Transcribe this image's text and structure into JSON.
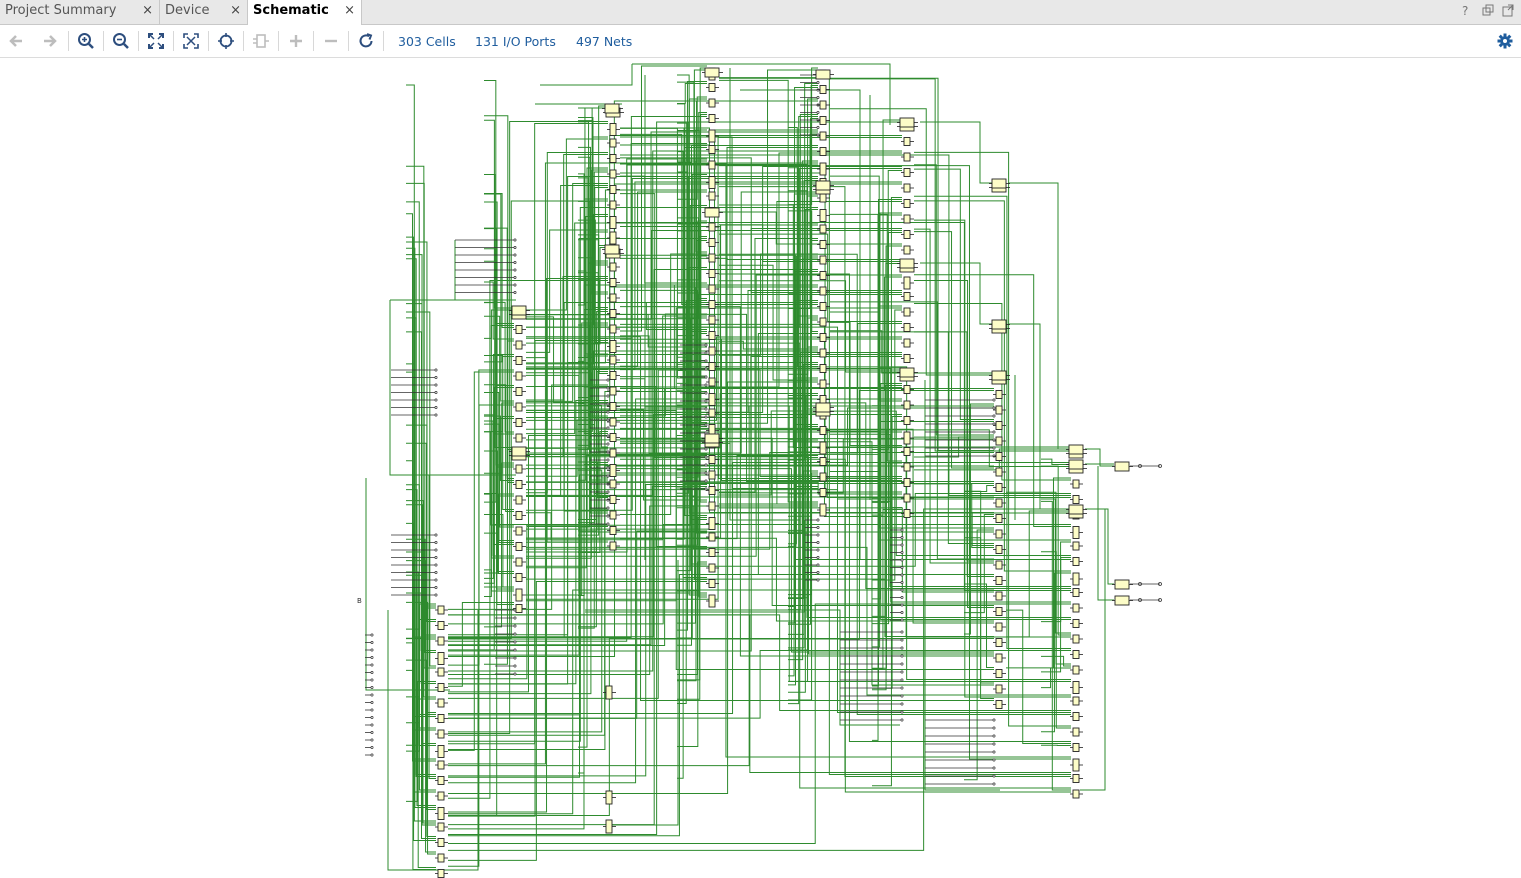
{
  "tabs": [
    {
      "label": "Project Summary",
      "active": false
    },
    {
      "label": "Device",
      "active": false
    },
    {
      "label": "Schematic",
      "active": true
    }
  ],
  "tab_close_glyph": "×",
  "window_controls": [
    "help-icon",
    "restore-icon",
    "popout-icon"
  ],
  "toolbar": {
    "buttons": [
      "back-icon",
      "forward-icon",
      "zoom-in-icon",
      "zoom-out-icon",
      "fit-icon",
      "zoom-fit-selection-icon",
      "autofit-icon",
      "expand-cone-icon",
      "expand-icon",
      "collapse-icon",
      "refresh-icon"
    ],
    "stats": {
      "cells": "303 Cells",
      "ports": "131 I/O Ports",
      "nets": "497 Nets"
    },
    "settings": "gear-icon"
  },
  "colors": {
    "wire": "#2e8b2e",
    "cell_fill": "#fdfdc8",
    "cell_stroke": "#222222",
    "link": "#1f5d9e"
  }
}
